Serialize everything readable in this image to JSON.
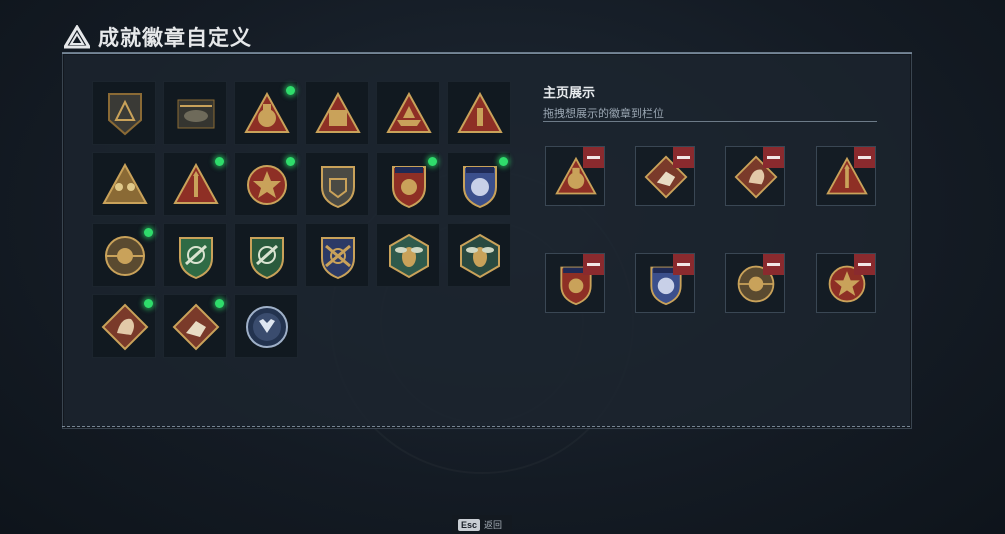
{
  "title": "成就徽章自定义",
  "colors": {
    "accent_green": "#2fdc6b",
    "remove_red": "#8a2a2e",
    "gold": "#c9a25a"
  },
  "badges": [
    {
      "name": "triangle-emblem-badge",
      "new": false
    },
    {
      "name": "helicopter-badge",
      "new": false
    },
    {
      "name": "money-bag-badge",
      "new": true
    },
    {
      "name": "supply-box-badge",
      "new": false
    },
    {
      "name": "boat-badge",
      "new": false
    },
    {
      "name": "number-one-badge",
      "new": false
    },
    {
      "name": "soldiers-badge",
      "new": false
    },
    {
      "name": "missile-badge",
      "new": true
    },
    {
      "name": "star-medal-badge",
      "new": true
    },
    {
      "name": "shield-hand-badge",
      "new": false
    },
    {
      "name": "red-stars-crest-badge",
      "new": true
    },
    {
      "name": "blue-stars-crest-badge",
      "new": true
    },
    {
      "name": "skull-coin-badge",
      "new": true
    },
    {
      "name": "green-rifle-shield-badge",
      "new": false
    },
    {
      "name": "green-rifle-wreath-badge",
      "new": false
    },
    {
      "name": "gold-rifle-shield-badge",
      "new": false
    },
    {
      "name": "wasp-hexagon-badge",
      "new": false
    },
    {
      "name": "wasp-hexagon-dark-badge",
      "new": false
    },
    {
      "name": "dragon-diamond-badge",
      "new": true
    },
    {
      "name": "runner-diamond-badge",
      "new": true
    },
    {
      "name": "wolf-round-badge",
      "new": false
    }
  ],
  "showcase": {
    "title": "主页展示",
    "subtitle": "拖拽想展示的徽章到栏位",
    "slots": [
      "money-bag-badge",
      "runner-diamond-badge",
      "dragon-diamond-badge",
      "missile-badge",
      "red-stars-crest-badge",
      "blue-stars-crest-badge",
      "skull-coin-badge",
      "star-medal-badge"
    ]
  },
  "footer": {
    "esc_key": "Esc",
    "esc_label": "返回"
  }
}
